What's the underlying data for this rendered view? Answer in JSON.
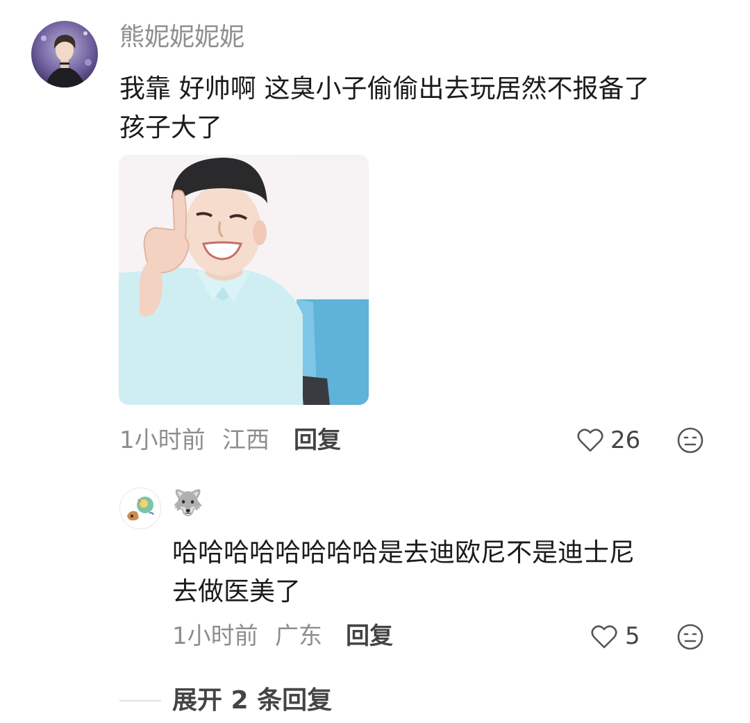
{
  "comment": {
    "username": "熊妮妮妮妮",
    "text_line1": "我靠 好帅啊 这臭小子偷偷出去玩居然不报备了",
    "text_line2": "孩子大了",
    "time": "1小时前",
    "location": "江西",
    "reply_label": "回复",
    "like_count": "26"
  },
  "reply": {
    "username_emoji": "🐺",
    "text_line1": "哈哈哈哈哈哈哈哈是去迪欧尼不是迪士尼",
    "text_line2": "去做医美了",
    "time": "1小时前",
    "location": "广东",
    "reply_label": "回复",
    "like_count": "5"
  },
  "expand": {
    "label": "展开 2 条回复"
  },
  "icons": {
    "heart": "heart-icon",
    "dislike": "meh-face-icon"
  },
  "colors": {
    "text": "#1b1b1b",
    "meta": "#8e8e8e",
    "action": "#444444"
  }
}
